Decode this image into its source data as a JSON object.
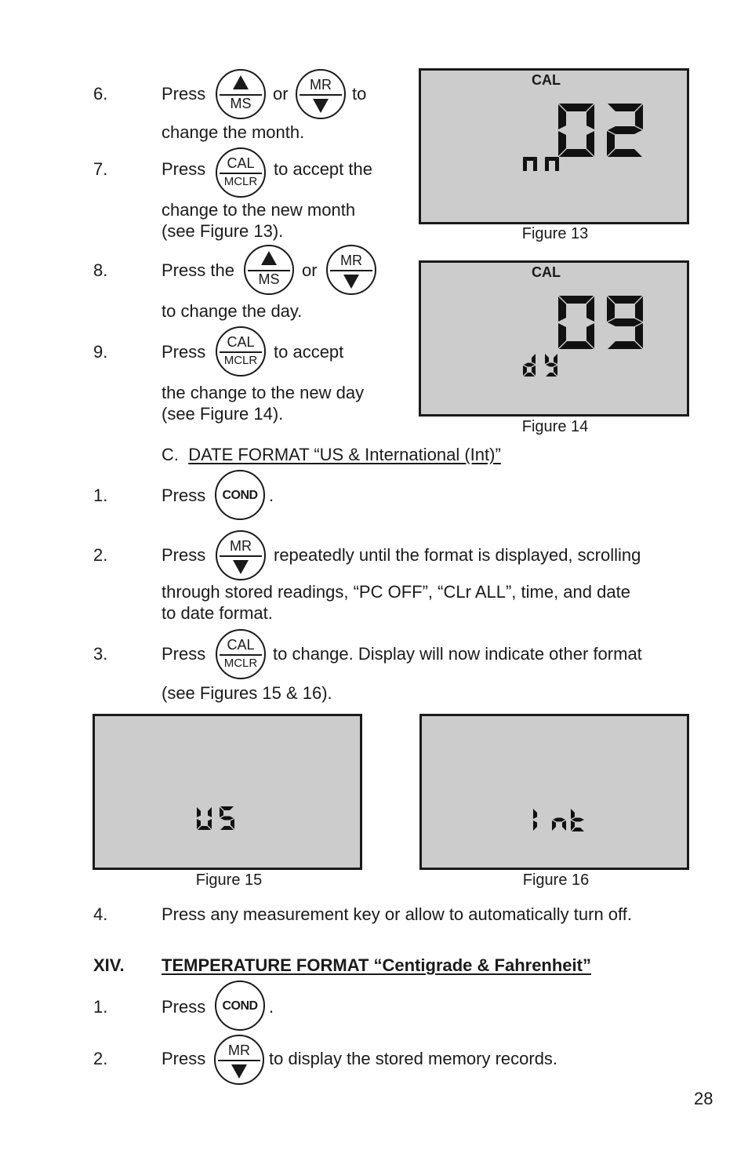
{
  "page_number": "28",
  "colors": {
    "lcd_background": "#cbcccb",
    "segment": "#111111",
    "ink": "#1a1a1a"
  },
  "steps_part_b": [
    {
      "num": "6.",
      "pre": "Press",
      "mid": "or",
      "post": "to",
      "line2": "change the month."
    },
    {
      "num": "7.",
      "pre": "Press",
      "post": "to accept the",
      "line2": "change to the new month",
      "line3": "(see Figure 13)."
    },
    {
      "num": "8.",
      "pre": "Press the",
      "mid": "or",
      "line2": "to change the day."
    },
    {
      "num": "9.",
      "pre": "Press",
      "post": "to accept",
      "line2": "the change to the new day",
      "line3": "(see Figure 14)."
    }
  ],
  "keys": {
    "ms": {
      "top_icon": "triangle-up",
      "bottom": "MS"
    },
    "mr": {
      "top": "MR",
      "bottom_icon": "triangle-down"
    },
    "cal": {
      "top": "CAL",
      "bottom": "MCLR"
    },
    "cond": {
      "label": "COND"
    }
  },
  "figures": {
    "fig13": {
      "caption": "Figure 13",
      "annunciator": "CAL",
      "main_digits": "02",
      "sub_label": "nn",
      "sub_label_meaning": "mm"
    },
    "fig14": {
      "caption": "Figure 14",
      "annunciator": "CAL",
      "main_digits": "09",
      "sub_label": "dy"
    },
    "fig15": {
      "caption": "Figure 15",
      "display": "US"
    },
    "fig16": {
      "caption": "Figure 16",
      "display": "Int"
    }
  },
  "section_c": {
    "prefix": "C.",
    "title": "DATE FORMAT “US & International (Int)”",
    "steps": [
      {
        "num": "1.",
        "pre": "Press",
        "post": "."
      },
      {
        "num": "2.",
        "pre": "Press",
        "post": "repeatedly until the format is displayed, scrolling",
        "line2": "through stored readings, “PC OFF”, “CLr ALL”, time, and date",
        "line3": "to date format."
      },
      {
        "num": "3.",
        "pre": "Press",
        "post": "to change. Display will now indicate other format",
        "line2": "(see Figures 15 & 16)."
      },
      {
        "num": "4.",
        "text": "Press any measurement key or allow to automatically turn off."
      }
    ]
  },
  "section_xiv": {
    "numeral": "XIV.",
    "title": "TEMPERATURE FORMAT “Centigrade & Fahrenheit”",
    "steps": [
      {
        "num": "1.",
        "pre": "Press",
        "post": "."
      },
      {
        "num": "2.",
        "pre": "Press",
        "post": "to display the stored memory records."
      }
    ]
  }
}
